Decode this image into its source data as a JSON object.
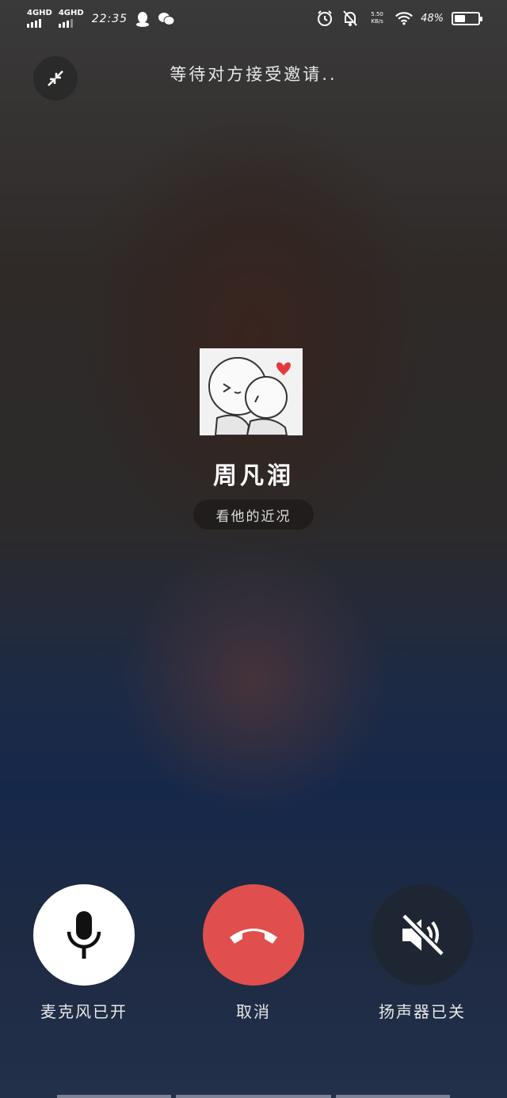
{
  "status_bar": {
    "network_1": "4GHD",
    "network_2": "4GHD",
    "time": "22:35",
    "net_speed_value": "5.50",
    "net_speed_unit": "KB/s",
    "battery_percent": "48%",
    "battery_level": 0.48
  },
  "header": {
    "status_text": "等待对方接受邀请.."
  },
  "contact": {
    "name": "周凡润",
    "recent_link": "看他的近况"
  },
  "controls": {
    "mic_label": "麦克风已开",
    "cancel_label": "取消",
    "speaker_label": "扬声器已关"
  },
  "colors": {
    "cancel_red": "#e04f4d",
    "mic_bg": "#ffffff",
    "speaker_bg": "#1f2633"
  },
  "icons": {
    "minimize": "minimize-arrows-icon",
    "mic": "microphone-icon",
    "hangup": "phone-hangup-icon",
    "speaker_off": "speaker-muted-icon"
  }
}
